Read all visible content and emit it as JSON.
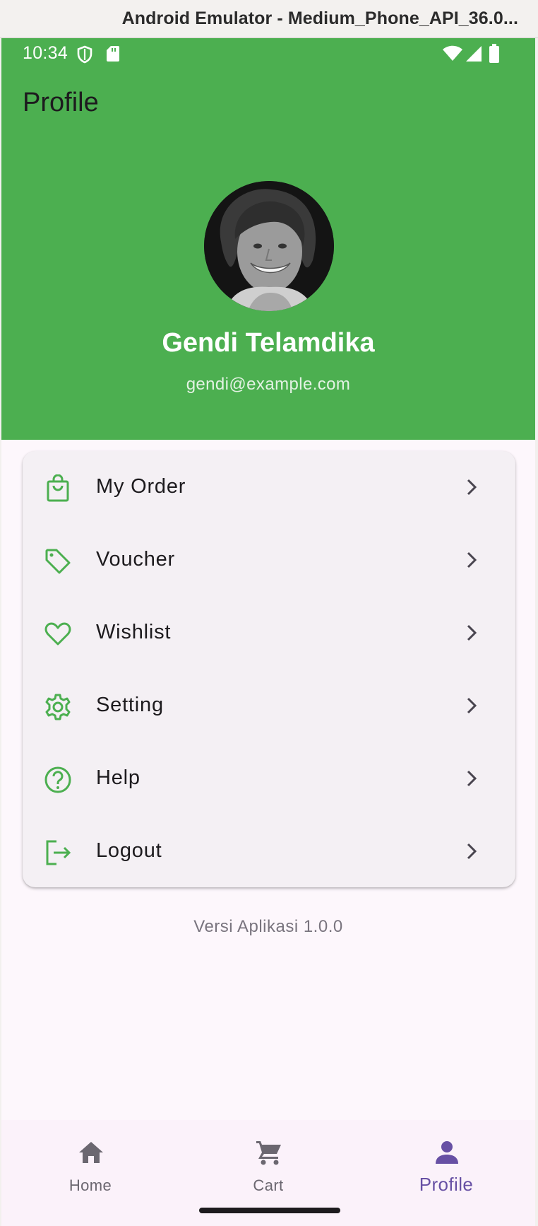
{
  "window": {
    "title": "Android Emulator - Medium_Phone_API_36.0..."
  },
  "status_bar": {
    "time": "10:34"
  },
  "app_bar": {
    "title": "Profile"
  },
  "profile": {
    "name": "Gendi Telamdika",
    "email": "gendi@example.com"
  },
  "menu": {
    "items": [
      {
        "label": "My Order",
        "icon": "shopping-bag-icon"
      },
      {
        "label": "Voucher",
        "icon": "tag-icon"
      },
      {
        "label": "Wishlist",
        "icon": "heart-icon"
      },
      {
        "label": "Setting",
        "icon": "gear-icon"
      },
      {
        "label": "Help",
        "icon": "help-circle-icon"
      },
      {
        "label": "Logout",
        "icon": "logout-icon"
      }
    ]
  },
  "footer": {
    "version": "Versi Aplikasi 1.0.0"
  },
  "bottom_nav": {
    "items": [
      {
        "label": "Home",
        "icon": "home-icon",
        "active": false
      },
      {
        "label": "Cart",
        "icon": "cart-icon",
        "active": false
      },
      {
        "label": "Profile",
        "icon": "person-icon",
        "active": true
      }
    ]
  },
  "colors": {
    "header_green": "#4caf50",
    "icon_green": "#4caf50",
    "nav_active": "#6750a4",
    "nav_inactive": "#6b6770",
    "card_bg": "#f4f0f4"
  }
}
